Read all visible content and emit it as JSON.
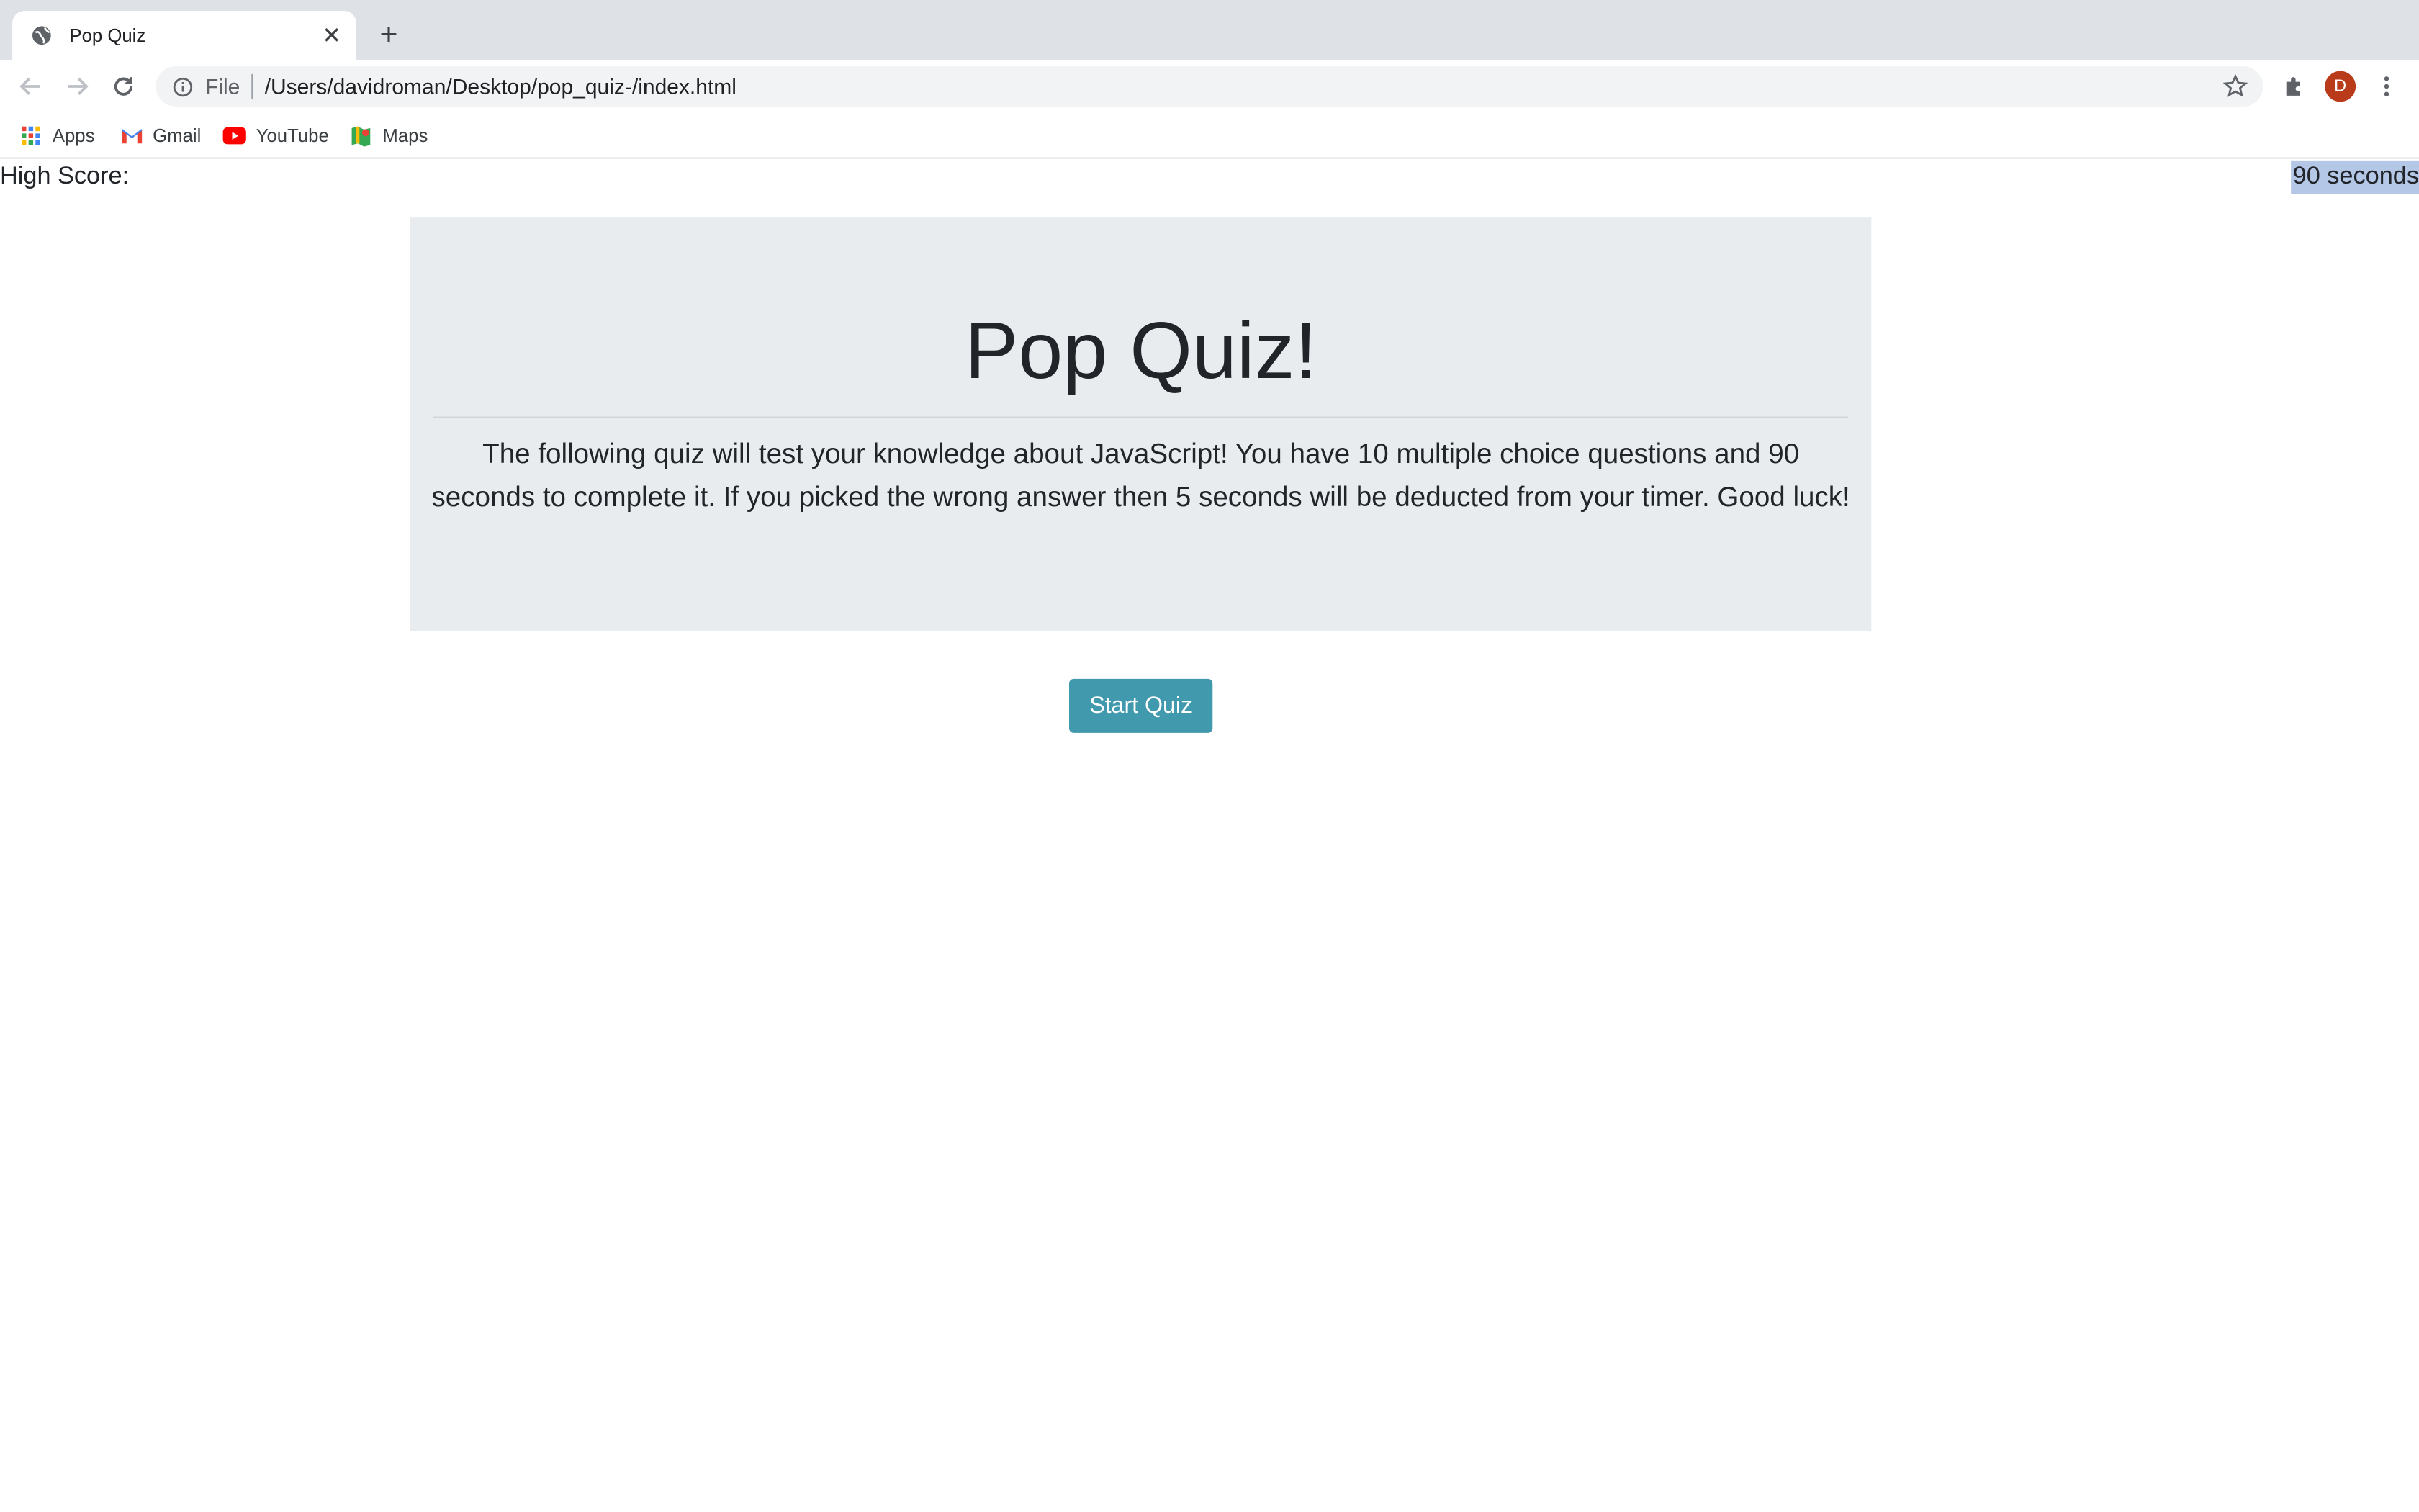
{
  "browser": {
    "tab_title": "Pop Quiz",
    "address_scheme": "File",
    "address_url": "/Users/davidroman/Desktop/pop_quiz-/index.html",
    "profile_initial": "D",
    "bookmarks": [
      {
        "label": "Apps",
        "icon": "apps-grid-icon"
      },
      {
        "label": "Gmail",
        "icon": "gmail-icon"
      },
      {
        "label": "YouTube",
        "icon": "youtube-icon"
      },
      {
        "label": "Maps",
        "icon": "maps-icon"
      }
    ]
  },
  "page": {
    "high_score_label": "High Score:",
    "timer_text": "90 seconds",
    "title": "Pop Quiz!",
    "description": "The following quiz will test your knowledge about JavaScript! You have 10 multiple choice questions and 90 seconds to complete it. If you picked the wrong answer then 5 seconds will be deducted from your timer. Good luck!",
    "start_button": "Start Quiz"
  },
  "colors": {
    "tabstrip": "#dee1e6",
    "jumbotron": "#e9ecef",
    "start_button": "#4199ae",
    "timer_highlight": "#b4c7e7",
    "avatar": "#b93b1a"
  }
}
